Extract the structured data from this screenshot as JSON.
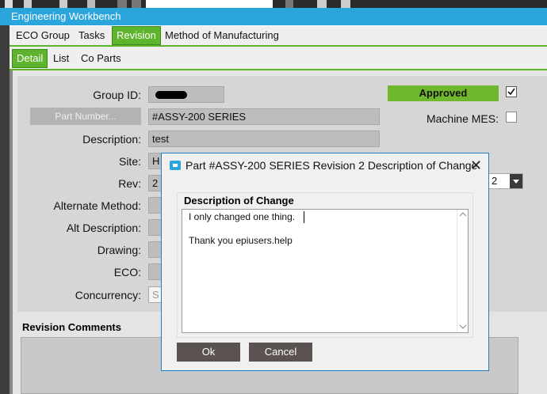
{
  "window": {
    "title": "Engineering Workbench"
  },
  "tabs": {
    "primary": [
      "ECO Group",
      "Tasks",
      "Revision",
      "Method of Manufacturing"
    ],
    "secondary": [
      "Detail",
      "List",
      "Co Parts"
    ]
  },
  "form": {
    "group_id_label": "Group ID:",
    "part_number_button": "Part Number...",
    "part_number_value": "#ASSY-200 SERIES",
    "description_label": "Description:",
    "description_value": "test",
    "site_label": "Site:",
    "site_value": "H",
    "rev_label": "Rev:",
    "rev_value": "2",
    "rev_dropdown_value": "2",
    "alternate_method_label": "Alternate Method:",
    "alt_description_label": "Alt Description:",
    "drawing_label": "Drawing:",
    "eco_label": "ECO:",
    "concurrency_label": "Concurrency:",
    "concurrency_value": "S",
    "approved_label": "Approved",
    "approved_checked": true,
    "machine_mes_label": "Machine MES:",
    "machine_mes_checked": false
  },
  "revision_comments": {
    "title": "Revision Comments"
  },
  "dialog": {
    "title": "Part #ASSY-200 SERIES Revision 2 Description of Change",
    "group_title": "Description of Change",
    "lines": [
      "I only changed one thing.",
      "",
      "Thank you epiusers.help"
    ],
    "ok_label": "Ok",
    "cancel_label": "Cancel"
  },
  "colors": {
    "accent": "#5fb42e",
    "titlebar": "#2aa6dd",
    "button_dark": "#5b5252"
  }
}
